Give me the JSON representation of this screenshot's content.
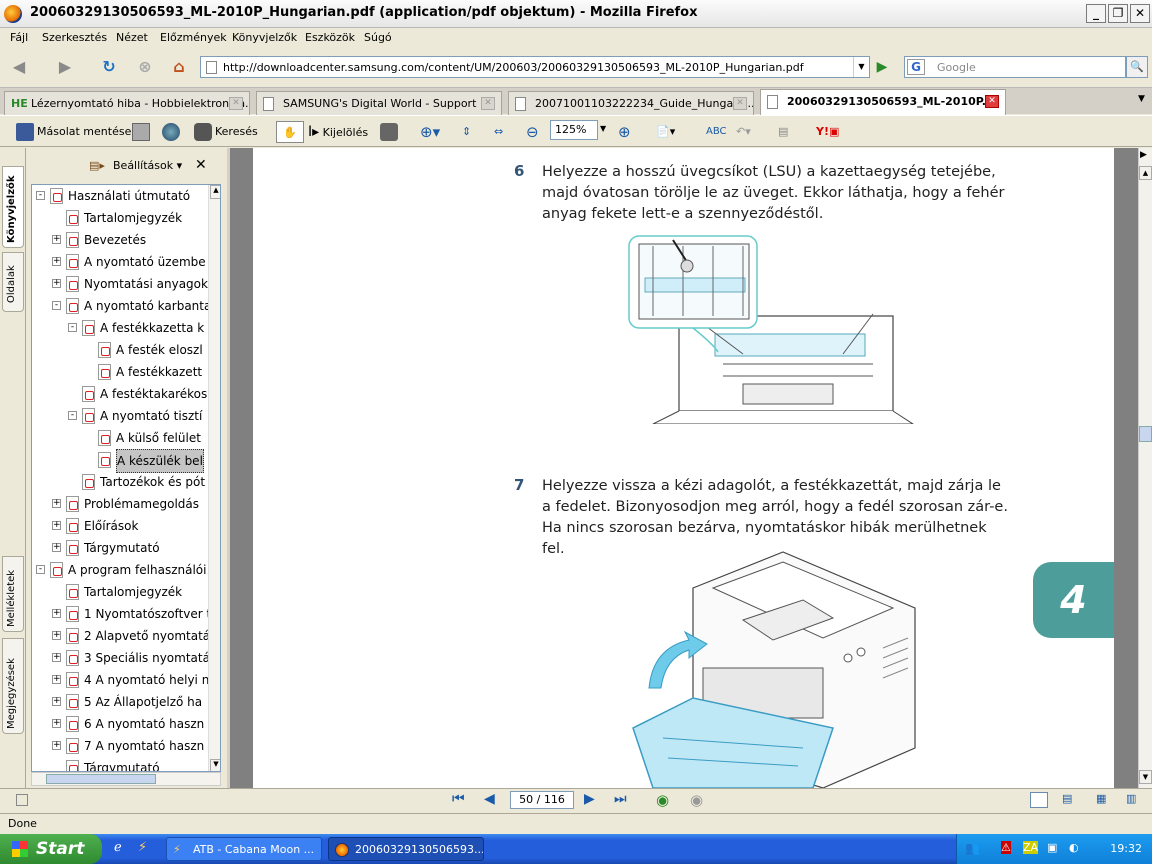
{
  "window": {
    "title": "20060329130506593_ML-2010P_Hungarian.pdf (application/pdf objektum) - Mozilla Firefox"
  },
  "menu": [
    "Fájl",
    "Szerkesztés",
    "Nézet",
    "Előzmények",
    "Könyvjelzők",
    "Eszközök",
    "Súgó"
  ],
  "nav": {
    "url": "http://downloadcenter.samsung.com/content/UM/200603/20060329130506593_ML-2010P_Hungarian.pdf",
    "search_placeholder": "Google"
  },
  "tabs": [
    {
      "label": "Lézernyomtató hiba - Hobbielektronika...",
      "icon": "he-icon"
    },
    {
      "label": "SAMSUNG's Digital World - Support",
      "icon": "page-icon"
    },
    {
      "label": "20071001103222234_Guide_Hungaria...",
      "icon": "page-icon"
    },
    {
      "label": "20060329130506593_ML-2010P...",
      "icon": "page-icon",
      "active": true
    }
  ],
  "pdf_toolbar": {
    "save": "Másolat mentése",
    "search": "Keresés",
    "select": "Kijelölés",
    "zoom": "125%"
  },
  "sidebar": {
    "settings": "Beállítások",
    "vtabs": [
      "Könyvjelzők",
      "Oldalak",
      "Mellékletek",
      "Megjegyzések"
    ],
    "bookmarks": [
      {
        "label": "Használati útmutató",
        "lvl": 0,
        "exp": "-"
      },
      {
        "label": "Tartalomjegyzék",
        "lvl": 1,
        "exp": ""
      },
      {
        "label": "Bevezetés",
        "lvl": 1,
        "exp": "+"
      },
      {
        "label": "A nyomtató üzembe",
        "lvl": 1,
        "exp": "+"
      },
      {
        "label": "Nyomtatási anyagok",
        "lvl": 1,
        "exp": "+"
      },
      {
        "label": "A nyomtató karbanta",
        "lvl": 1,
        "exp": "-"
      },
      {
        "label": "A festékkazetta k",
        "lvl": 2,
        "exp": "-"
      },
      {
        "label": "A festék eloszl",
        "lvl": 3,
        "exp": ""
      },
      {
        "label": "A festékkazett",
        "lvl": 3,
        "exp": ""
      },
      {
        "label": "A festéktakarékos",
        "lvl": 2,
        "exp": ""
      },
      {
        "label": "A nyomtató tisztí",
        "lvl": 2,
        "exp": "-"
      },
      {
        "label": "A külső felület",
        "lvl": 3,
        "exp": ""
      },
      {
        "label": "A készülék bel",
        "lvl": 3,
        "exp": "",
        "sel": true
      },
      {
        "label": "Tartozékok és pót",
        "lvl": 2,
        "exp": ""
      },
      {
        "label": "Problémamegoldás",
        "lvl": 1,
        "exp": "+"
      },
      {
        "label": "Előírások",
        "lvl": 1,
        "exp": "+"
      },
      {
        "label": "Tárgymutató",
        "lvl": 1,
        "exp": "+"
      },
      {
        "label": "A program felhasználói",
        "lvl": 0,
        "exp": "-"
      },
      {
        "label": "Tartalomjegyzék",
        "lvl": 1,
        "exp": ""
      },
      {
        "label": "1 Nyomtatószoftver t",
        "lvl": 1,
        "exp": "+"
      },
      {
        "label": "2 Alapvető nyomtatá",
        "lvl": 1,
        "exp": "+"
      },
      {
        "label": "3 Speciális nyomtatá",
        "lvl": 1,
        "exp": "+"
      },
      {
        "label": "4 A nyomtató helyi n",
        "lvl": 1,
        "exp": "+"
      },
      {
        "label": "5 Az Állapotjelző ha",
        "lvl": 1,
        "exp": "+"
      },
      {
        "label": "6 A nyomtató haszn",
        "lvl": 1,
        "exp": "+"
      },
      {
        "label": "7 A nyomtató haszn",
        "lvl": 1,
        "exp": "+"
      },
      {
        "label": "Tárgymutató",
        "lvl": 1,
        "exp": ""
      }
    ]
  },
  "doc": {
    "step6_num": "6",
    "step6_text": "Helyezze a hosszú üvegcsíkot (LSU) a kazettaegység tetejébe, majd óvatosan törölje le az üveget. Ekkor láthatja, hogy a fehér anyag fekete lett-e a szennyeződéstől.",
    "step7_num": "7",
    "step7_text": "Helyezze vissza a kézi adagolót, a festékkazettát, majd zárja le a fedelet. Bizonyosodjon meg arról, hogy a fedél szorosan zár-e. Ha nincs szorosan bezárva, nyomtatáskor hibák merülhetnek fel.",
    "chapter": "4"
  },
  "pager": {
    "page": "50 / 116"
  },
  "status": "Done",
  "taskbar": {
    "start": "Start",
    "items": [
      "ATB - Cabana Moon ...",
      "20060329130506593..."
    ],
    "clock": "19:32"
  }
}
